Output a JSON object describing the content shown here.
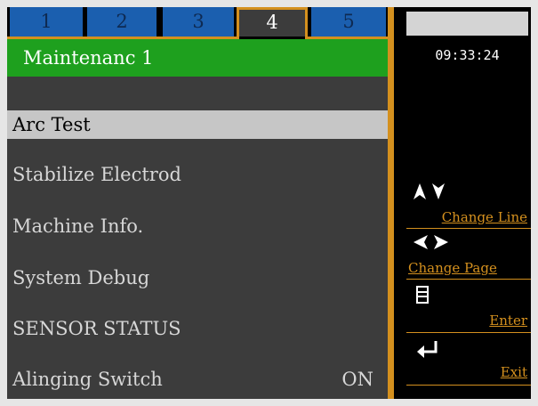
{
  "tabs": [
    {
      "label": "1"
    },
    {
      "label": "2"
    },
    {
      "label": "3"
    },
    {
      "label": "4"
    },
    {
      "label": "5"
    }
  ],
  "active_tab": "4",
  "title": "Maintenanc 1",
  "menu": {
    "items": [
      {
        "label": "Arc Test",
        "selected": true
      },
      {
        "label": "Stabilize Electrod"
      },
      {
        "label": "Machine Info."
      },
      {
        "label": "System Debug"
      },
      {
        "label": "SENSOR STATUS"
      },
      {
        "label": "Alinging Switch",
        "value": "ON"
      }
    ]
  },
  "clock": "09:33:24",
  "hints": {
    "change_line": "Change Line",
    "change_page": "Change Page",
    "enter": "Enter",
    "exit": "Exit"
  },
  "icons": {
    "change_line": "up-down-arrows-icon",
    "change_page": "left-right-arrows-icon",
    "enter": "document-icon",
    "exit": "return-arrow-icon"
  },
  "colors": {
    "tab_blue": "#1b5faf",
    "accent_orange": "#d4901e",
    "title_green": "#1ea01e",
    "panel_gray": "#3c3c3c",
    "selected_row": "#c6c6c6"
  }
}
